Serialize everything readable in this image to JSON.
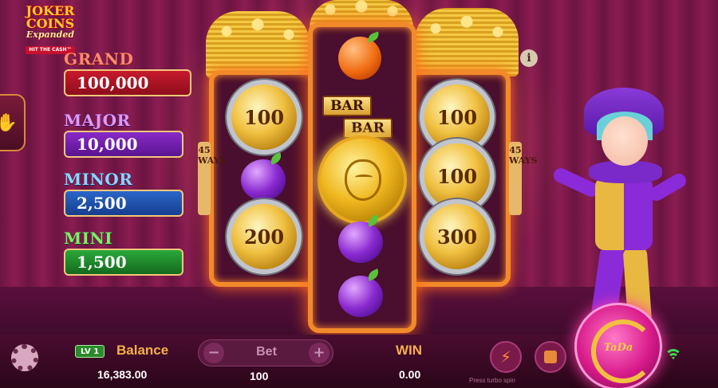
{
  "game": {
    "logo_line1": "JOKER COINS",
    "logo_line2": "Expanded",
    "logo_line3": "HIT THE CASH™"
  },
  "jackpots": [
    {
      "name": "GRAND",
      "value": "100,000",
      "color": "#c61a2c"
    },
    {
      "name": "MAJOR",
      "value": "10,000",
      "color": "#8a2ac8"
    },
    {
      "name": "MINOR",
      "value": "2,500",
      "color": "#2a66c8"
    },
    {
      "name": "MINI",
      "value": "1,500",
      "color": "#2aa83a"
    }
  ],
  "reels": {
    "ways_left": "45 WAYS",
    "ways_right": "45 WAYS",
    "reel1": [
      {
        "type": "coin",
        "value": "100"
      },
      {
        "type": "plum"
      },
      {
        "type": "coin",
        "value": "200"
      }
    ],
    "reel2": [
      {
        "type": "orange"
      },
      {
        "type": "bar",
        "label": "BAR"
      },
      {
        "type": "bar",
        "label": "BAR"
      },
      {
        "type": "joker-coin"
      },
      {
        "type": "plum"
      },
      {
        "type": "plum"
      }
    ],
    "reel3": [
      {
        "type": "coin",
        "value": "100"
      },
      {
        "type": "coin",
        "value": "100"
      },
      {
        "type": "coin",
        "value": "300"
      }
    ]
  },
  "info_label": "i",
  "bottom_bar": {
    "level": "LV 1",
    "balance_label": "Balance",
    "balance_value": "16,383.00",
    "bet_label": "Bet",
    "bet_minus": "−",
    "bet_plus": "+",
    "bet_value": "100",
    "win_label": "WIN",
    "win_value": "0.00",
    "turbo_hint": "Press turbo spin",
    "spin_label": "TaDa"
  },
  "icons": {
    "settings": "gear-icon",
    "info": "info-icon",
    "turbo": "lightning-icon",
    "stop": "stop-icon",
    "spin": "spin-icon",
    "network": "wifi-icon",
    "side_tab": "hand-icon"
  },
  "colors": {
    "accent": "#f5b04a",
    "frame": "#f28a2a",
    "spin": "#d81a8a"
  }
}
